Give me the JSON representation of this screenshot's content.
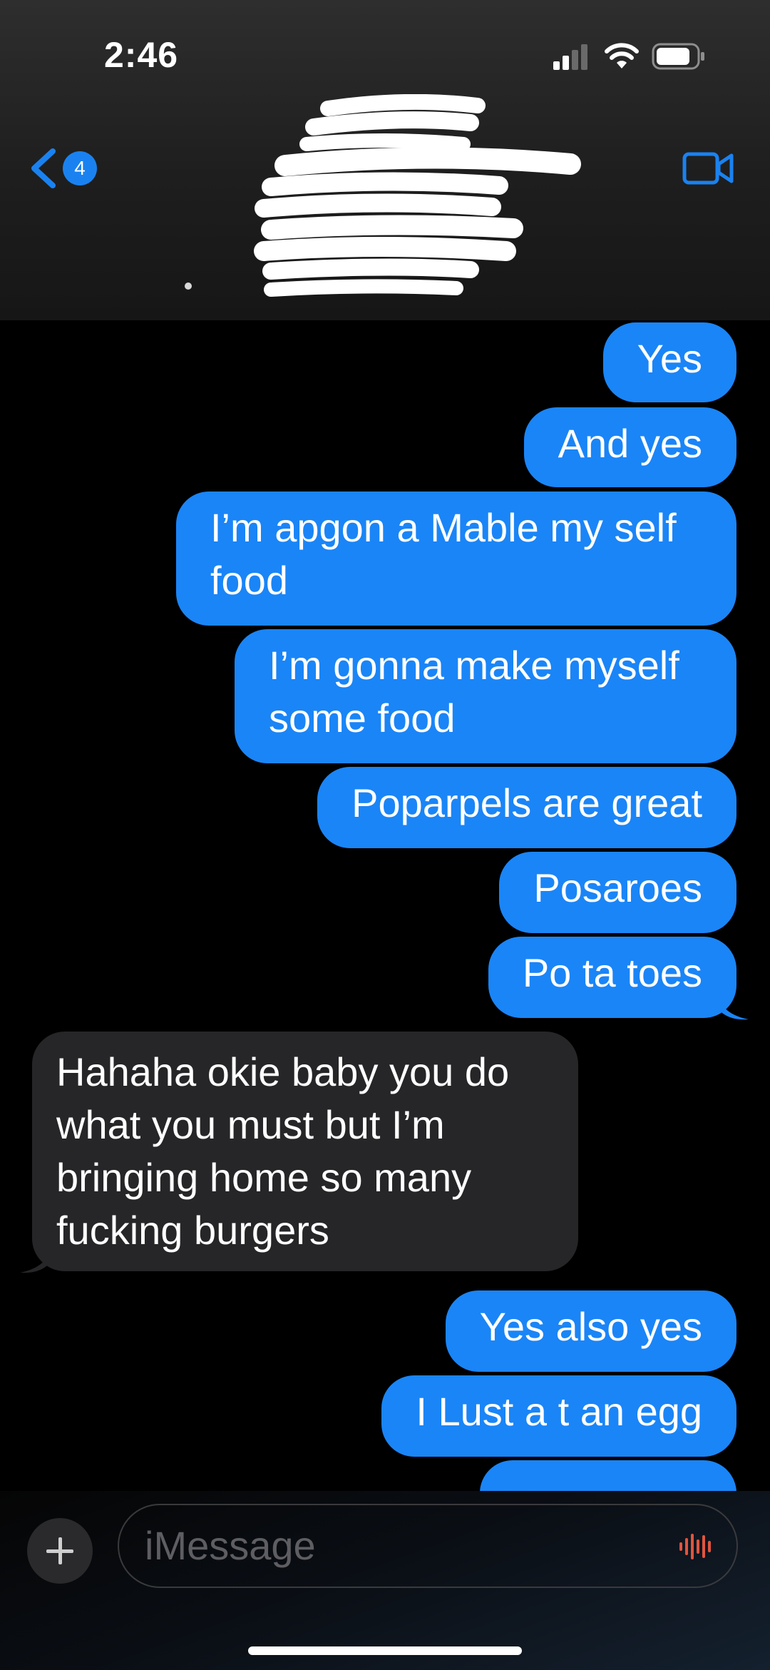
{
  "status_bar": {
    "time": "2:46"
  },
  "nav": {
    "back_badge_count": "4",
    "back_icon": "chevron-left-icon",
    "video_icon": "video-camera-icon"
  },
  "messages": [
    {
      "from": "me",
      "text": "Yes"
    },
    {
      "from": "me",
      "text": "And yes"
    },
    {
      "from": "me",
      "text": "I’m apgon a Mable my self food"
    },
    {
      "from": "me",
      "text": "I’m gonna make myself some food"
    },
    {
      "from": "me",
      "text": "Poparpels are great"
    },
    {
      "from": "me",
      "text": "Posaroes"
    },
    {
      "from": "me",
      "text": "Po ta toes"
    },
    {
      "from": "them",
      "text": "Hahaha okie baby you do what you must but I’m bringing home so many fucking burgers"
    },
    {
      "from": "me",
      "text": "Yes also yes"
    },
    {
      "from": "me",
      "text": "I Lust a t an egg"
    }
  ],
  "composer": {
    "placeholder": "iMessage",
    "add_icon": "plus-icon",
    "audio_icon": "audio-waveform-icon"
  },
  "colors": {
    "sent_bubble": "#1a85f7",
    "received_bubble": "#262628",
    "accent": "#1a82f0",
    "mic": "#e0553f"
  }
}
